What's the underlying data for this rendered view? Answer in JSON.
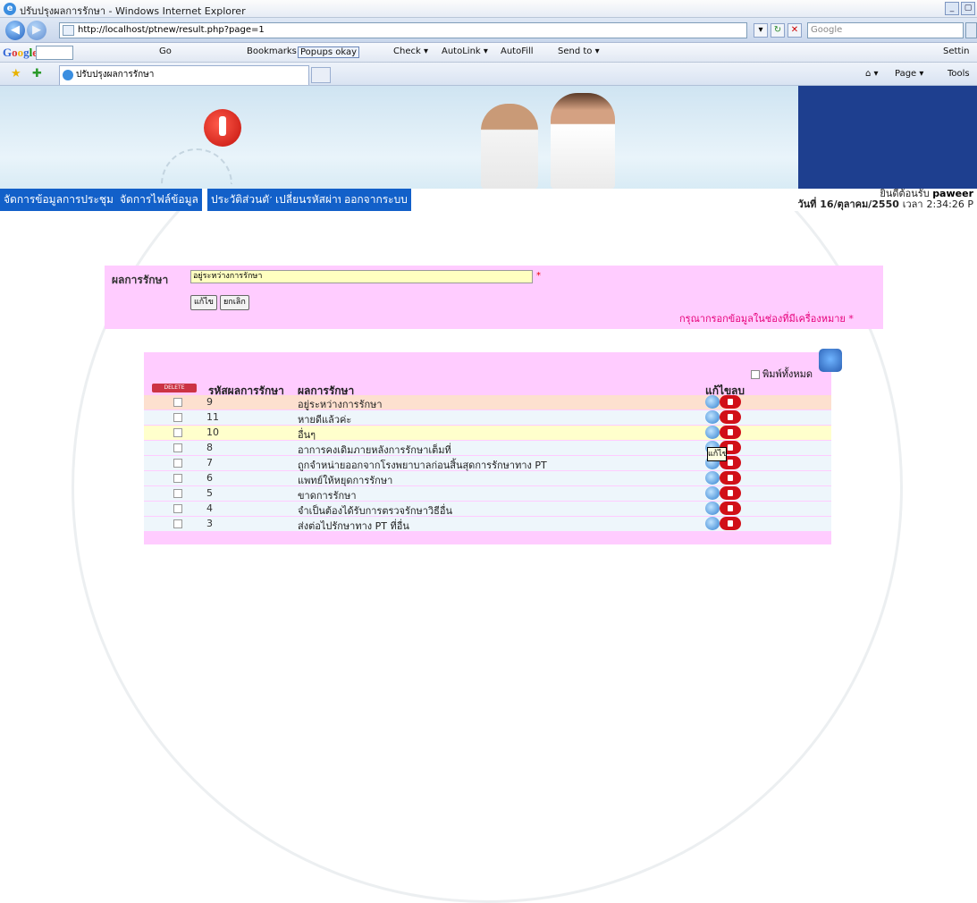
{
  "window": {
    "title": "ปรับปรุงผลการรักษา - Windows Internet Explorer",
    "controls": [
      "_",
      "▢"
    ]
  },
  "address": {
    "url": "http://localhost/ptnew/result.php?page=1",
    "search_placeholder": "Google"
  },
  "google_toolbar": {
    "logo": "Google",
    "items": [
      "Go",
      "Bookmarks ▾",
      "Popups okay",
      "Check ▾",
      "AutoLink ▾",
      "AutoFill",
      "Send to ▾"
    ],
    "settings": "Settin"
  },
  "fav_bar": {
    "tab_title": "ปรับปรุงผลการรักษา",
    "page_menu": "Page ▾",
    "tools_menu": "Tools"
  },
  "menu": {
    "items": [
      "จัดการข้อมูลการประชุม",
      "จัดการไฟล์ข้อมูล",
      "ประวัติส่วนตัว",
      "เปลี่ยนรหัสผ่าน",
      "ออกจากระบบ"
    ]
  },
  "welcome": {
    "line1_prefix": "ยินดีต้อนรับ",
    "user": "paweer",
    "line2_prefix": "วันที่",
    "date": "16/ตุลาคม/2550",
    "time_prefix": "เวลา",
    "time": "2:34:26 P"
  },
  "form": {
    "label": "ผลการรักษา",
    "value": "อยู่ระหว่างการรักษา",
    "required": "*",
    "edit_button": "แก้ไข",
    "cancel_button": "ยกเลิก",
    "hint": "กรุณากรอกข้อมูลในช่องที่มีเครื่องหมาย *"
  },
  "table": {
    "print_all": "พิมพ์ทั้งหมด",
    "delete_label": "DELETE",
    "headers": {
      "code": "รหัสผลการรักษา",
      "result": "ผลการรักษา",
      "edit": "แก้ไข",
      "delete": "ลบ"
    },
    "row_colors": [
      "#fde0cf",
      "#eef6fb",
      "#ffffcc",
      "#eef6fb",
      "#eef6fb",
      "#eef6fb",
      "#eef6fb",
      "#eef6fb",
      "#eef6fb"
    ],
    "rows": [
      {
        "id": "9",
        "text": "อยู่ระหว่างการรักษา"
      },
      {
        "id": "11",
        "text": "หายดีแล้วค่ะ"
      },
      {
        "id": "10",
        "text": "อื่นๆ"
      },
      {
        "id": "8",
        "text": "อาการคงเดิมภายหลังการรักษาเต็มที่"
      },
      {
        "id": "7",
        "text": "ถูกจำหน่ายออกจากโรงพยาบาลก่อนสิ้นสุดการรักษาทาง PT"
      },
      {
        "id": "6",
        "text": "แพทย์ให้หยุดการรักษา"
      },
      {
        "id": "5",
        "text": "ขาดการรักษา"
      },
      {
        "id": "4",
        "text": "จำเป็นต้องได้รับการตรวจรักษาวิธีอื่น"
      },
      {
        "id": "3",
        "text": "ส่งต่อไปรักษาทาง PT ที่อื่น"
      }
    ],
    "tooltip": "แก้ไข"
  }
}
